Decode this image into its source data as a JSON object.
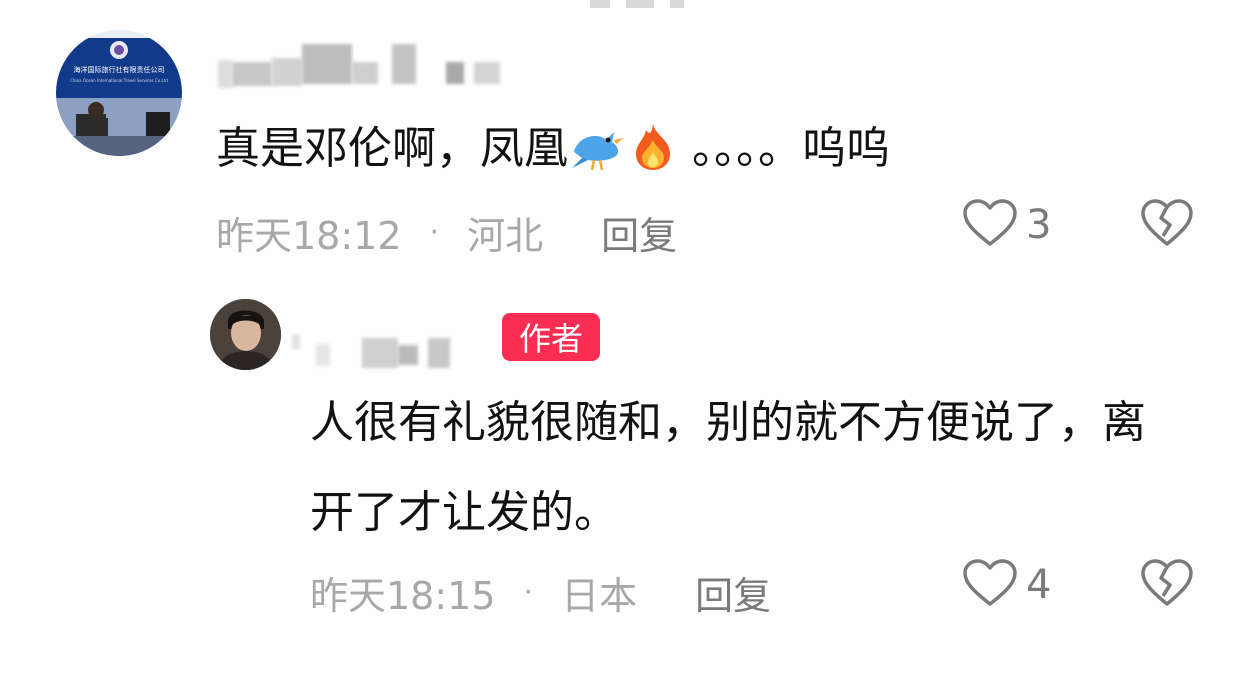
{
  "comments": [
    {
      "text_before": "真是邓伦啊，凤凰",
      "text_after": "。。。。呜呜",
      "emoji": [
        "bird-emoji",
        "fire-emoji"
      ],
      "time": "昨天18:12",
      "location": "河北",
      "reply_label": "回复",
      "likes": "3",
      "avatar_sign_line1": "海洋国际旅行社有限责任公司",
      "avatar_sign_line2": "China Ocean International Travel Services Co.Ltd"
    }
  ],
  "reply": {
    "badge": "作者",
    "text": "人很有礼貌很随和，别的就不方便说了，离开了才让发的。",
    "time": "昨天18:15",
    "location": "日本",
    "reply_label": "回复",
    "likes": "4"
  },
  "colors": {
    "badge": "#fb2d52",
    "meta": "#a8a8a8",
    "action": "#7a7a7a",
    "text": "#121212"
  },
  "icons": [
    "heart-outline-icon",
    "broken-heart-icon",
    "bird-emoji",
    "fire-emoji"
  ]
}
